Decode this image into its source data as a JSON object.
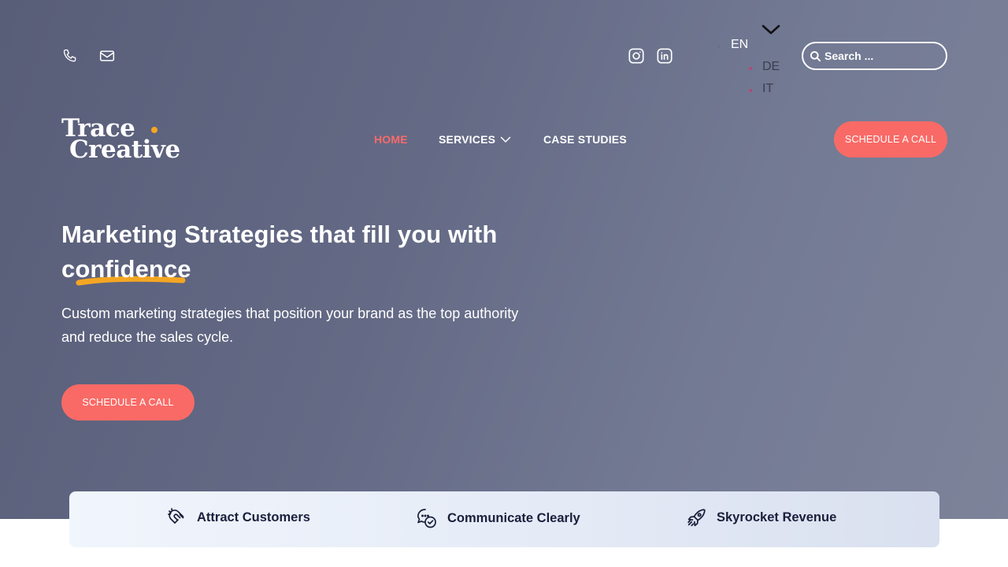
{
  "topbar": {
    "phone_icon": "phone-icon",
    "mail_icon": "mail-icon",
    "social": [
      "instagram-icon",
      "linkedin-icon"
    ],
    "languages": [
      "EN",
      "DE",
      "IT"
    ],
    "search_placeholder": "Search ..."
  },
  "brand": {
    "line1": "Trace",
    "line2": "Creative",
    "accent": "#f4a623"
  },
  "nav": {
    "items": [
      {
        "label": "HOME",
        "active": true
      },
      {
        "label": "SERVICES",
        "dropdown": true
      },
      {
        "label": "CASE STUDIES"
      }
    ],
    "cta": "SCHEDULE A CALL"
  },
  "hero": {
    "title_part1": "Marketing Strategies that fill you with",
    "title_highlight": "confidence",
    "subtitle": "Custom marketing strategies that position your brand as the top authority and reduce the sales cycle.",
    "cta": "SCHEDULE A CALL"
  },
  "features": [
    {
      "icon": "magnet-icon",
      "label": "Attract Customers"
    },
    {
      "icon": "chat-bubbles-icon",
      "label": "Communicate Clearly"
    },
    {
      "icon": "rocket-icon",
      "label": "Skyrocket Revenue"
    }
  ],
  "colors": {
    "coral": "#f96a66",
    "highlight_underline": "#f4a623",
    "feature_text": "#1a1f3c"
  }
}
